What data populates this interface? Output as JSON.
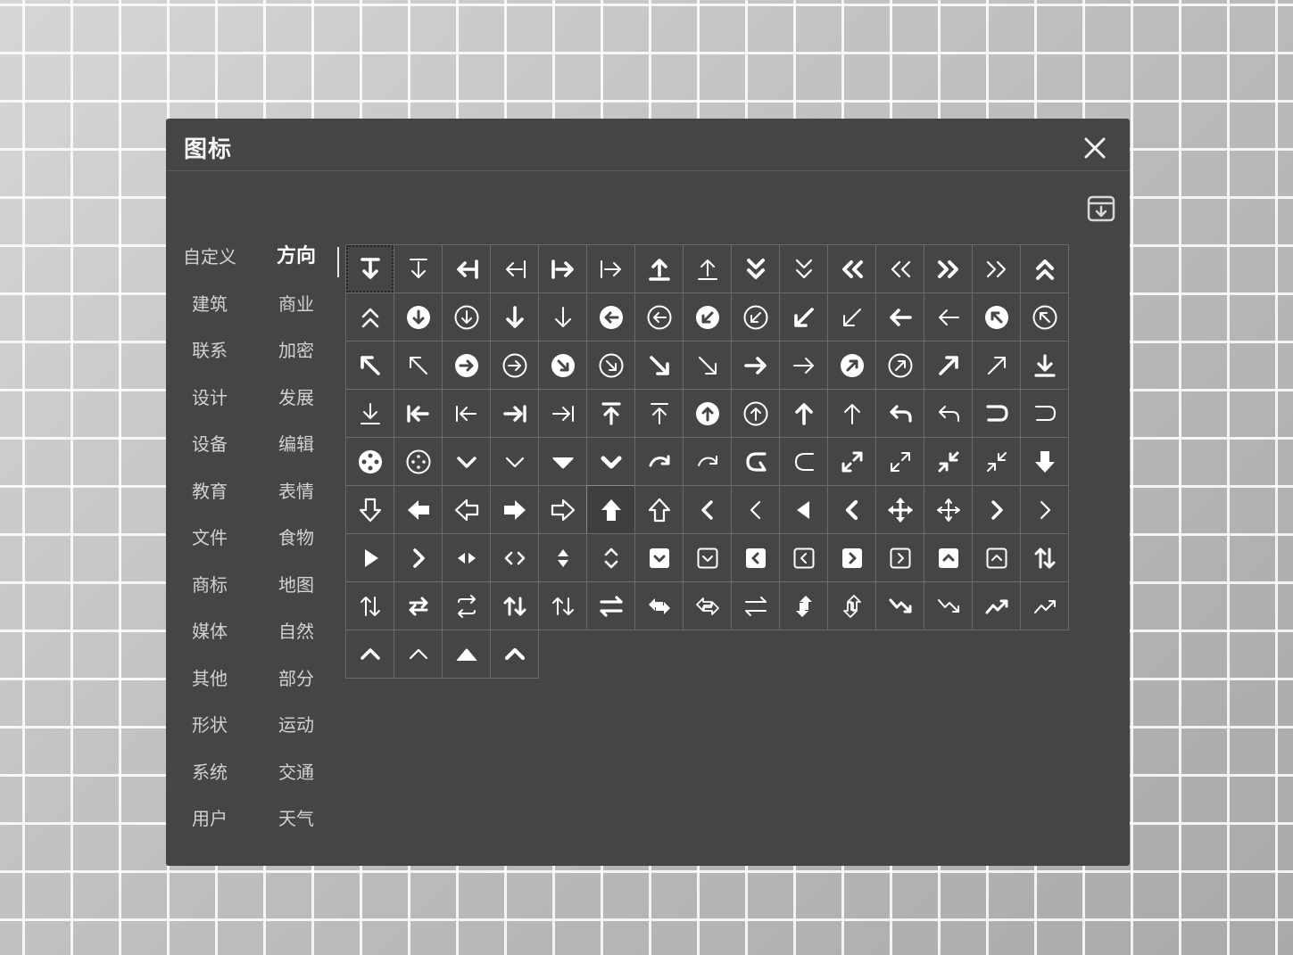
{
  "dialog": {
    "title": "图标"
  },
  "icons": {
    "close": "close-icon",
    "download": "download-box-icon"
  },
  "categories": [
    {
      "label": "自定义",
      "active": false
    },
    {
      "label": "方向",
      "active": true
    },
    {
      "label": "建筑",
      "active": false
    },
    {
      "label": "商业",
      "active": false
    },
    {
      "label": "联系",
      "active": false
    },
    {
      "label": "加密",
      "active": false
    },
    {
      "label": "设计",
      "active": false
    },
    {
      "label": "发展",
      "active": false
    },
    {
      "label": "设备",
      "active": false
    },
    {
      "label": "编辑",
      "active": false
    },
    {
      "label": "教育",
      "active": false
    },
    {
      "label": "表情",
      "active": false
    },
    {
      "label": "文件",
      "active": false
    },
    {
      "label": "食物",
      "active": false
    },
    {
      "label": "商标",
      "active": false
    },
    {
      "label": "地图",
      "active": false
    },
    {
      "label": "媒体",
      "active": false
    },
    {
      "label": "自然",
      "active": false
    },
    {
      "label": "其他",
      "active": false
    },
    {
      "label": "部分",
      "active": false
    },
    {
      "label": "形状",
      "active": false
    },
    {
      "label": "运动",
      "active": false
    },
    {
      "label": "系统",
      "active": false
    },
    {
      "label": "交通",
      "active": false
    },
    {
      "label": "用户",
      "active": false
    },
    {
      "label": "天气",
      "active": false
    }
  ],
  "icon_grid": {
    "selected_index": 0,
    "hovered_index": 80,
    "items": [
      "arrow-down-to-line-bold",
      "arrow-down-to-line",
      "arrow-left-to-line-bold",
      "arrow-left-to-line",
      "arrow-right-from-line-bold",
      "arrow-right-from-line",
      "arrow-up-from-line-bold",
      "arrow-up-from-line",
      "chevrons-down-bold",
      "chevrons-down",
      "chevrons-left-bold",
      "chevrons-left",
      "chevrons-right-bold",
      "chevrons-right",
      "chevrons-up-bold",
      "chevrons-up",
      "circle-arrow-down-solid",
      "circle-arrow-down",
      "arrow-down-bold",
      "arrow-down",
      "circle-arrow-left-solid",
      "circle-arrow-left",
      "circle-arrow-down-left-solid",
      "circle-arrow-down-left",
      "arrow-down-left-bold",
      "arrow-down-left",
      "arrow-left-bold",
      "arrow-left",
      "circle-arrow-up-left-solid",
      "circle-arrow-up-left",
      "arrow-up-left-bold",
      "arrow-up-left",
      "circle-arrow-right-solid",
      "circle-arrow-right",
      "circle-arrow-down-right-solid",
      "circle-arrow-down-right",
      "arrow-down-right-bold",
      "arrow-down-right",
      "arrow-right-bold",
      "arrow-right",
      "circle-arrow-up-right-solid",
      "circle-arrow-up-right",
      "arrow-up-right-bold",
      "arrow-up-right",
      "download-bold",
      "download",
      "arrow-left-from-bar-bold",
      "arrow-left-from-bar",
      "arrow-right-to-bar-bold",
      "arrow-right-to-bar",
      "arrow-up-to-line-bold",
      "arrow-up-to-line",
      "circle-arrow-up-solid",
      "circle-arrow-up",
      "arrow-up-bold",
      "arrow-up",
      "undo-bold",
      "undo",
      "return-bold",
      "return",
      "circle-dots-solid",
      "circle-dots",
      "chevron-down-bold",
      "chevron-down",
      "caret-down-wide",
      "chevron-down-heavy",
      "redo-bold",
      "redo",
      "rotate-left-bold",
      "rotate-left",
      "expand-bold",
      "expand",
      "compress-bold",
      "compress",
      "arrow-down-solid",
      "arrow-down-outline",
      "arrow-left-solid",
      "arrow-left-outline",
      "arrow-right-solid",
      "arrow-right-outline",
      "arrow-up-solid",
      "arrow-up-outline",
      "chevron-left-bold",
      "chevron-left",
      "caret-left",
      "chevron-left-heavy",
      "move-bold",
      "move",
      "chevron-right-bold",
      "chevron-right",
      "caret-right",
      "chevron-right-heavy",
      "caret-left-right",
      "chevrons-left-right",
      "caret-up-down",
      "chevrons-up-down",
      "square-chevron-down-solid",
      "square-chevron-down",
      "square-chevron-left-solid",
      "square-chevron-left",
      "square-chevron-right-solid",
      "square-chevron-right",
      "square-chevron-up-solid",
      "square-chevron-up",
      "arrows-up-down-bold",
      "arrows-up-down",
      "repeat-bold",
      "repeat",
      "arrows-swap-vertical-bold",
      "arrows-swap-vertical",
      "arrows-swap-horizontal-bold",
      "arrows-exchange-solid",
      "arrows-exchange-outline",
      "arrows-swap-horizontal",
      "arrows-vertical-solid",
      "arrows-vertical-outline",
      "trend-down-bold",
      "trend-down",
      "trend-up-bold",
      "trend-up",
      "chevron-up-bold",
      "chevron-up",
      "caret-up",
      "chevron-up-heavy"
    ]
  }
}
